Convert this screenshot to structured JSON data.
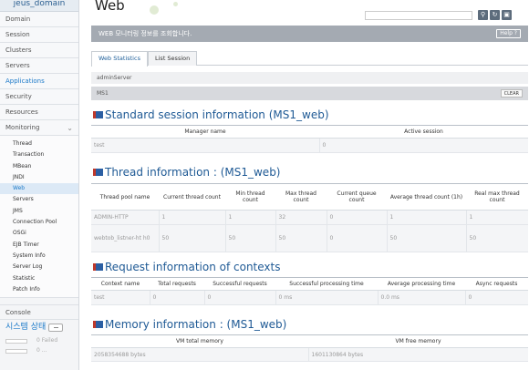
{
  "sidebar": {
    "domain_name": "jeus_domain",
    "menu": [
      {
        "label": "Domain"
      },
      {
        "label": "Session"
      },
      {
        "label": "Clusters"
      },
      {
        "label": "Servers"
      },
      {
        "label": "Applications"
      },
      {
        "label": "Security"
      },
      {
        "label": "Resources"
      }
    ],
    "monitoring_label": "Monitoring",
    "monitoring_items": [
      {
        "label": "Thread"
      },
      {
        "label": "Transaction"
      },
      {
        "label": "MBean"
      },
      {
        "label": "JNDI"
      },
      {
        "label": "Web"
      },
      {
        "label": "Servers"
      },
      {
        "label": "JMS"
      },
      {
        "label": "Connection Pool"
      },
      {
        "label": "OSGi"
      },
      {
        "label": "EJB Timer"
      },
      {
        "label": "System Info"
      },
      {
        "label": "Server Log"
      },
      {
        "label": "Statistic"
      },
      {
        "label": "Patch Info"
      }
    ],
    "console_label": "Console",
    "system_status_label": "시스템 상태",
    "status_rows": [
      {
        "label": "0 Failed"
      },
      {
        "label": "0 ..."
      }
    ]
  },
  "main": {
    "title": "Web",
    "banner_text": "WEB 모니터링 정보를 조회합니다.",
    "help_label": "Help ?",
    "tabs": [
      {
        "label": "Web Statistics"
      },
      {
        "label": "List Session"
      }
    ],
    "server_name": "adminServer",
    "ms_name": "MS1",
    "clear_label": "CLEAR"
  },
  "session_info": {
    "title": "Standard session information (MS1_web)",
    "headers": [
      "Manager name",
      "Active session"
    ],
    "rows": [
      [
        "test",
        "0"
      ]
    ]
  },
  "thread_info": {
    "title": "Thread information : (MS1_web)",
    "headers": [
      "Thread pool name",
      "Current thread count",
      "Min thread count",
      "Max thread count",
      "Current queue count",
      "Average thread count (1h)",
      "Real max thread count"
    ],
    "rows": [
      [
        "ADMIN-HTTP",
        "1",
        "1",
        "32",
        "0",
        "1",
        "1"
      ],
      [
        "webtob_listner-ht h0",
        "50",
        "50",
        "50",
        "0",
        "50",
        "50"
      ]
    ]
  },
  "request_info": {
    "title": "Request information of contexts",
    "headers": [
      "Context name",
      "Total requests",
      "Successful requests",
      "Successful processing time",
      "Average processing time",
      "Async requests"
    ],
    "rows": [
      [
        "test",
        "0",
        "0",
        "0 ms",
        "0.0 ms",
        "0"
      ]
    ]
  },
  "memory_info": {
    "title": "Memory information : (MS1_web)",
    "headers": [
      "VM total memory",
      "VM free memory"
    ],
    "rows": [
      [
        "2058354688 bytes",
        "1601130864 bytes"
      ]
    ]
  }
}
